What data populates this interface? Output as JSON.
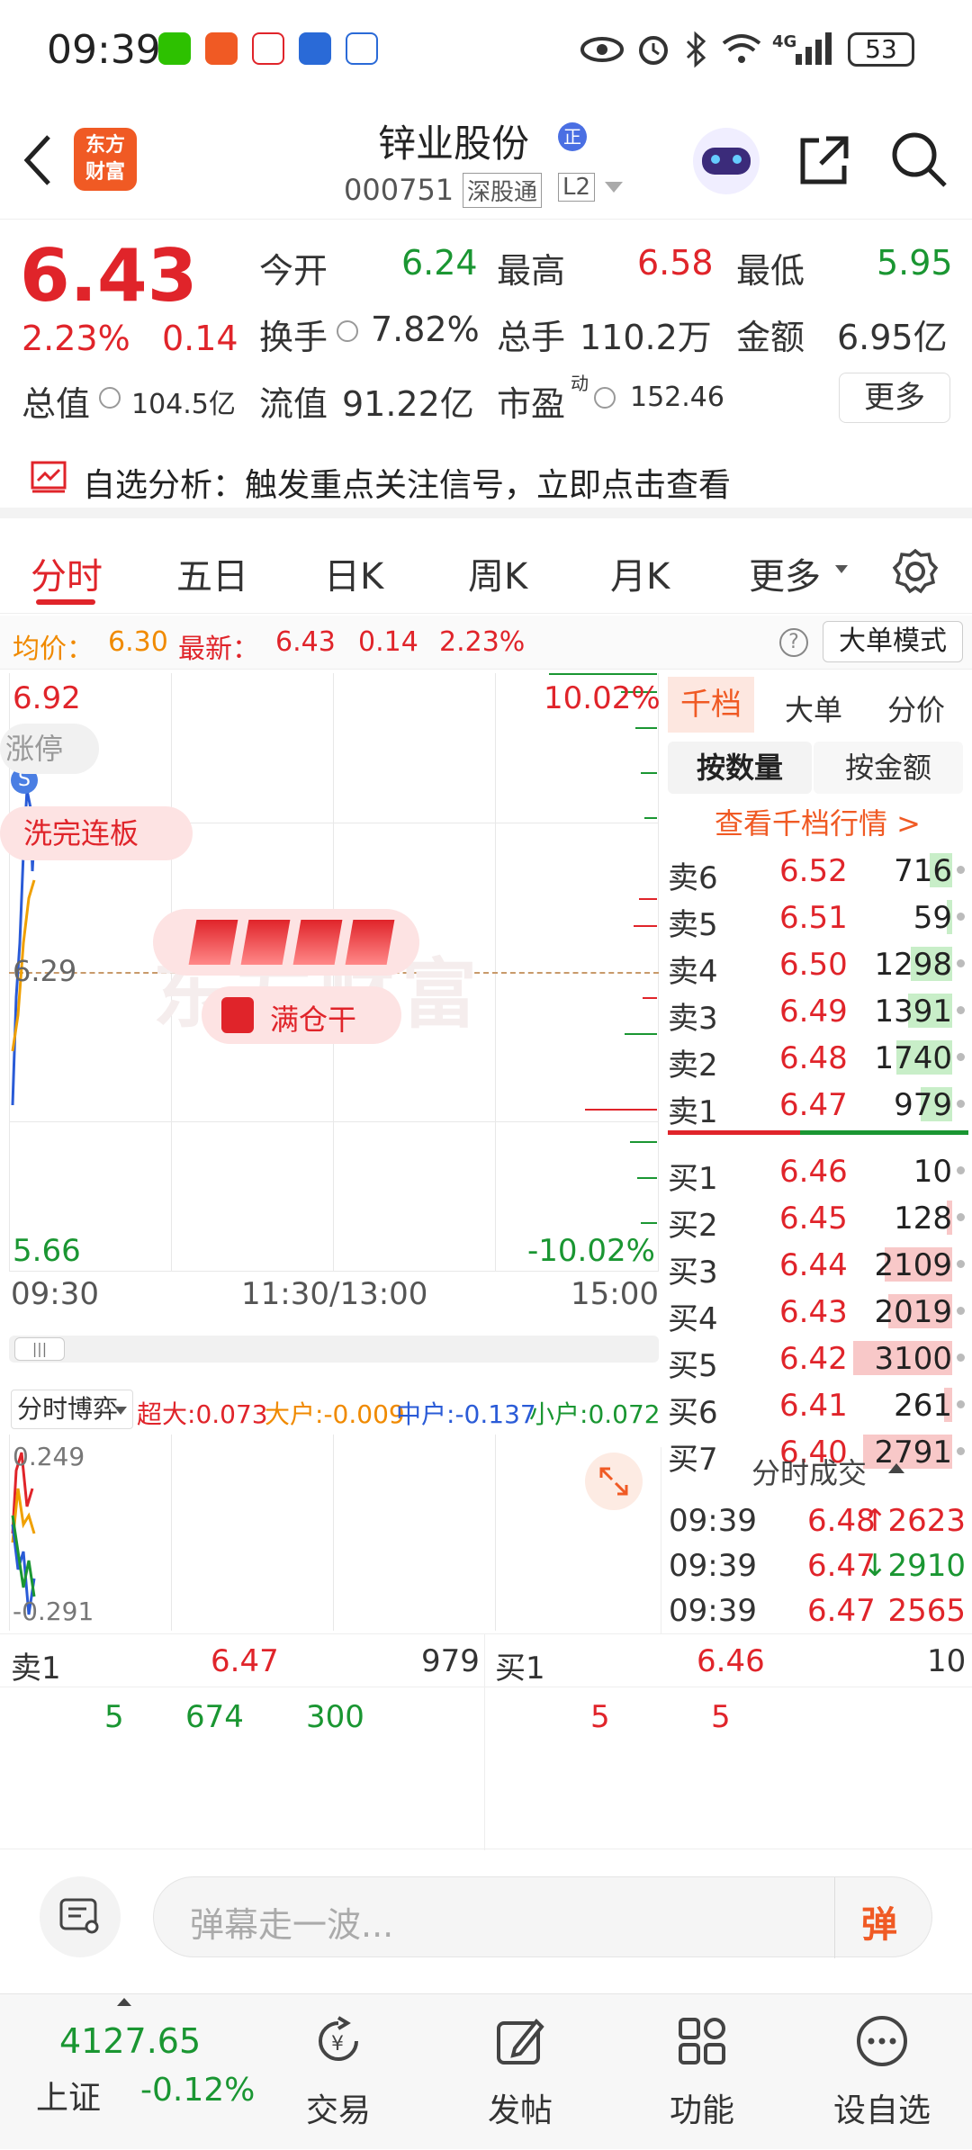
{
  "status": {
    "time": "09:39",
    "network": "4G",
    "battery": "53"
  },
  "header": {
    "app_logo_line1": "东方",
    "app_logo_line2": "财富",
    "stock_name": "锌业股份",
    "badge": "正",
    "stock_code": "000751",
    "tag_connect": "深股通",
    "tag_level": "L2"
  },
  "quote": {
    "price": "6.43",
    "change_pct": "2.23%",
    "change": "0.14",
    "open_label": "今开",
    "open": "6.24",
    "high_label": "最高",
    "high": "6.58",
    "low_label": "最低",
    "low": "5.95",
    "turnover_label": "换手",
    "turnover": "7.82%",
    "volume_label": "总手",
    "volume": "110.2万",
    "amount_label": "金额",
    "amount": "6.95亿",
    "mcap_label": "总值",
    "mcap": "104.5亿",
    "float_label": "流值",
    "float": "91.22亿",
    "pe_label": "市盈",
    "pe_sup": "动",
    "pe": "152.46",
    "more_button": "更多"
  },
  "notice": {
    "text": "自选分析：触发重点关注信号，立即点击查看"
  },
  "tabs": {
    "items": [
      "分时",
      "五日",
      "日K",
      "周K",
      "月K"
    ],
    "more": "更多"
  },
  "infobar": {
    "avg_label": "均价：",
    "avg": "6.30",
    "latest_label": "最新：",
    "latest": "6.43",
    "change": "0.14",
    "pct": "2.23%",
    "mode_button": "大单模式"
  },
  "chart": {
    "y_top": "6.92",
    "y_mid": "6.29",
    "y_bottom": "5.66",
    "pct_top": "10.02%",
    "pct_bottom": "-10.02%",
    "x_labels": [
      "09:30",
      "11:30/13:00",
      "15:00"
    ],
    "bubble_limit": "涨停",
    "bubble_wash": "洗完连板",
    "bubble_full": "满仓干",
    "signal": "S",
    "watermark": "东方财富"
  },
  "book": {
    "tabs": [
      "千档",
      "大单",
      "分价"
    ],
    "sub_tabs": [
      "按数量",
      "按金额"
    ],
    "link": "查看千档行情 >",
    "asks": [
      {
        "label": "卖6",
        "price": "6.52",
        "vol": "716",
        "bar": 0.23
      },
      {
        "label": "卖5",
        "price": "6.51",
        "vol": "59",
        "bar": 0.02
      },
      {
        "label": "卖4",
        "price": "6.50",
        "vol": "1298",
        "bar": 0.42
      },
      {
        "label": "卖3",
        "price": "6.49",
        "vol": "1391",
        "bar": 0.45
      },
      {
        "label": "卖2",
        "price": "6.48",
        "vol": "1740",
        "bar": 0.56
      },
      {
        "label": "卖1",
        "price": "6.47",
        "vol": "979",
        "bar": 0.32
      }
    ],
    "bids": [
      {
        "label": "买1",
        "price": "6.46",
        "vol": "10",
        "bar": 0.0
      },
      {
        "label": "买2",
        "price": "6.45",
        "vol": "128",
        "bar": 0.04
      },
      {
        "label": "买3",
        "price": "6.44",
        "vol": "2109",
        "bar": 0.68
      },
      {
        "label": "买4",
        "price": "6.43",
        "vol": "2019",
        "bar": 0.65
      },
      {
        "label": "买5",
        "price": "6.42",
        "vol": "3100",
        "bar": 1.0
      },
      {
        "label": "买6",
        "price": "6.41",
        "vol": "261",
        "bar": 0.08
      },
      {
        "label": "买7",
        "price": "6.40",
        "vol": "2791",
        "bar": 0.9
      }
    ],
    "trades_title": "分时成交",
    "trades": [
      {
        "time": "09:39",
        "price": "6.48",
        "vol": "↑2623"
      },
      {
        "time": "09:39",
        "price": "6.47",
        "vol": "↓2910"
      },
      {
        "time": "09:39",
        "price": "6.47",
        "vol": "2565"
      }
    ]
  },
  "flow": {
    "selector": "分时博弈",
    "super_label": "超大:",
    "super": "0.073",
    "big_label": "大户:",
    "big": "-0.009",
    "mid_label": "中户:",
    "mid": "-0.137",
    "small_label": "小户:",
    "small": "0.072",
    "mini_top": "0.249",
    "mini_bottom": "-0.291"
  },
  "depth": {
    "sell_label": "卖1",
    "sell_price": "6.47",
    "sell_vol": "979",
    "buy_label": "买1",
    "buy_price": "6.46",
    "buy_vol": "10",
    "sell_orders": [
      "5",
      "674",
      "300"
    ],
    "buy_orders": [
      "5",
      "5"
    ]
  },
  "comment": {
    "placeholder": "弹幕走一波...",
    "danmu": "弹"
  },
  "bottom": {
    "index_value": "4127.65",
    "index_name": "上证",
    "index_change": "-0.12%",
    "nav": [
      "交易",
      "发帖",
      "功能",
      "设自选"
    ]
  },
  "colors": {
    "up": "#e0242a",
    "down": "#1a9632",
    "accent": "#f05a24"
  }
}
